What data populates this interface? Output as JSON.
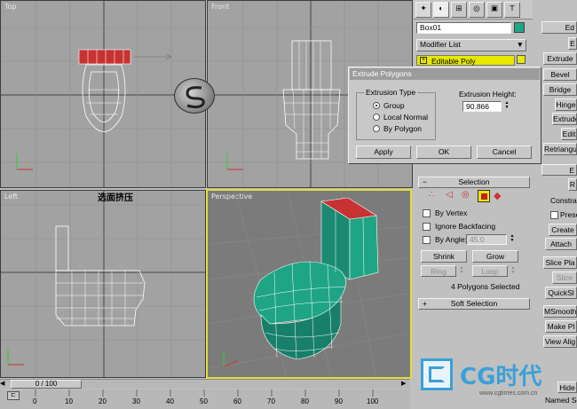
{
  "viewports": {
    "top": {
      "label": "Top"
    },
    "front": {
      "label": "Front"
    },
    "left": {
      "label": "Left"
    },
    "perspective": {
      "label": "Perspective"
    },
    "overlay_text": "选面挤压"
  },
  "command_panel": {
    "object_name": "Box01",
    "object_color": "#1fa585",
    "modifier_list_label": "Modifier List",
    "stack_item": "Editable Poly",
    "stack_item_color": "#e8e800",
    "selection_rollout": {
      "title": "Selection",
      "by_vertex": "By Vertex",
      "ignore_backfacing": "Ignore Backfacing",
      "by_angle": "By Angle:",
      "by_angle_value": "45.0",
      "shrink": "Shrink",
      "grow": "Grow",
      "ring": "Ring",
      "loop": "Loop",
      "status": "4 Polygons Selected"
    },
    "soft_selection_rollout": {
      "title": "Soft Selection"
    }
  },
  "right_panel": {
    "buttons": [
      "Ed",
      "E",
      "Extrude",
      "Bevel",
      "Bridge",
      "Hinge",
      "Extrude",
      "Edit",
      "Retriangul",
      "E",
      "R",
      "Constrai",
      "Prese",
      "Create",
      "Attach",
      "Slice Pla",
      "Slice",
      "QuickSl",
      "MSmooth",
      "Make Pl",
      "View Alig",
      "Hide",
      "Named Se"
    ]
  },
  "dialog": {
    "title": "Extrude Polygons",
    "extrusion_type_label": "Extrusion Type",
    "options": [
      "Group",
      "Local Normal",
      "By Polygon"
    ],
    "selected_option": "Group",
    "height_label": "Extrusion Height:",
    "height_value": "90.866",
    "apply": "Apply",
    "ok": "OK",
    "cancel": "Cancel"
  },
  "timeline": {
    "frame_display": "0 / 100",
    "ticks": [
      "0",
      "10",
      "20",
      "30",
      "40",
      "50",
      "60",
      "70",
      "80",
      "90",
      "100"
    ]
  },
  "watermark": {
    "brand": "CG时代",
    "url": "www.cgtimes.com.cn"
  },
  "colors": {
    "teal": "#1fa585",
    "selection_red": "#c83232",
    "viewport_bg": "#a2a2a2",
    "persp_bg": "#7b7b7b",
    "active_border": "#e6dc3c"
  }
}
